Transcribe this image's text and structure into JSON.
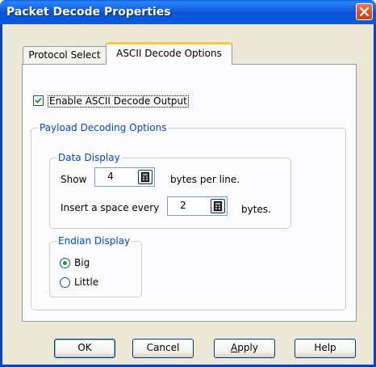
{
  "window": {
    "title": "Packet Decode Properties",
    "colors": {
      "titlebar": "#0a5fe0",
      "frame": "#ece9d8",
      "group_title": "#0046d5",
      "tab_highlight": "#ffc83c",
      "close": "#d9542b"
    }
  },
  "tabs": [
    {
      "label": "Protocol Select",
      "selected": false
    },
    {
      "label": "ASCII Decode Options",
      "selected": true
    }
  ],
  "enable_ascii": {
    "label": "Enable ASCII Decode Output",
    "checked": true
  },
  "payload_group": {
    "title": "Payload Decoding Options"
  },
  "data_display": {
    "title": "Data Display",
    "show_label": "Show",
    "show_value": "4",
    "show_suffix": "bytes per line.",
    "space_label": "Insert a space every",
    "space_value": "2",
    "space_suffix": "bytes."
  },
  "endian": {
    "title": "Endian Display",
    "options": [
      {
        "label": "Big",
        "selected": true
      },
      {
        "label": "Little",
        "selected": false
      }
    ]
  },
  "buttons": {
    "ok": "OK",
    "cancel": "Cancel",
    "apply_mnemonic": "A",
    "apply_rest": "pply",
    "help": "Help"
  },
  "icons": {
    "close": "close-icon",
    "checkmark": "checkmark-icon",
    "spin": "calculator-icon",
    "radio": "radio-dot-icon"
  }
}
